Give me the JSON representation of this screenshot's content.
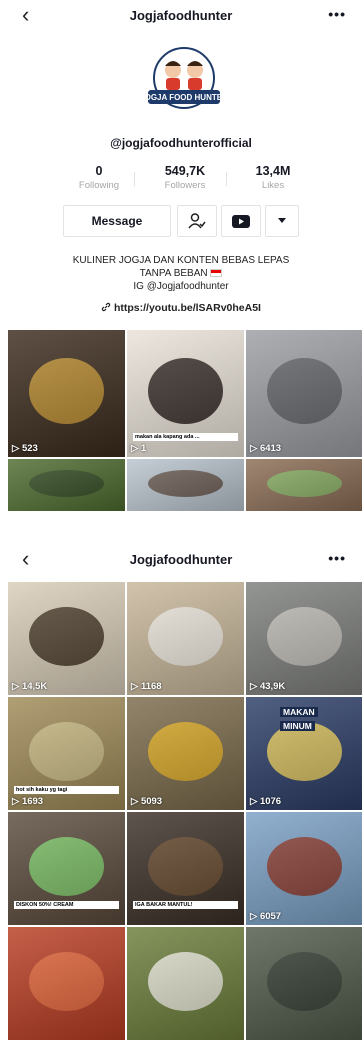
{
  "header": {
    "title": "Jogjafoodhunter",
    "back_icon": "chevron-left-icon",
    "more_icon": "more-dots-icon"
  },
  "profile": {
    "logo_text": "JOGJA FOOD HUNTER",
    "handle": "@jogjafoodhunterofficial",
    "stats": [
      {
        "value": "0",
        "label": "Following"
      },
      {
        "value": "549,7K",
        "label": "Followers"
      },
      {
        "value": "13,4M",
        "label": "Likes"
      }
    ],
    "message_label": "Message",
    "bio_line1": "KULINER JOGJA DAN KONTEN BEBAS LEPAS",
    "bio_line2": "TANPA BEBAN",
    "bio_line3": "IG @Jogjafoodhunter",
    "link": "https://youtu.be/lSARv0heA5I"
  },
  "grid1": [
    {
      "views": "523",
      "bg": "#3b2a1c",
      "accent": "#c9962f"
    },
    {
      "views": "1",
      "bg": "#e9e2d8",
      "accent": "#1e1410",
      "caption": "makan ala kapang ada ..."
    },
    {
      "views": "6413",
      "bg": "#9c9ea3",
      "accent": "#5a5c61"
    },
    {
      "views": "",
      "bg": "#4d6b2e",
      "accent": "#2f4520"
    },
    {
      "views": "",
      "bg": "#b9c3cd",
      "accent": "#5d4c3f"
    },
    {
      "views": "",
      "bg": "#8a6c54",
      "accent": "#86b965"
    }
  ],
  "grid2": [
    {
      "views": "14,5K",
      "bg": "#d8cdb8",
      "accent": "#3a2a18"
    },
    {
      "views": "1168",
      "bg": "#c8b79a",
      "accent": "#f2efe8"
    },
    {
      "views": "43,9K",
      "bg": "#7d7f7c",
      "accent": "#c9c6bf"
    },
    {
      "views": "1693",
      "bg": "#9f8a57",
      "accent": "#cfc08a",
      "caption": "hot sih kaku yg tagi"
    },
    {
      "views": "5093",
      "bg": "#7a6a4a",
      "accent": "#e6b01f"
    },
    {
      "views": "1076",
      "bg": "#2b3c66",
      "accent": "#f0d15a",
      "sign1": "MAKAN",
      "sign2": "MINUM"
    },
    {
      "views": "",
      "bg": "#5a4a3c",
      "accent": "#7fd06a",
      "caption": "DISKON 50%! CREAM"
    },
    {
      "views": "",
      "bg": "#3a2f26",
      "accent": "#6b4b2e",
      "caption": "IGA BAKAR MANTUL!"
    },
    {
      "views": "6057",
      "bg": "#7aa0c4",
      "accent": "#8b2f1e"
    },
    {
      "views": "",
      "bg": "#b83c22",
      "accent": "#e86a3c"
    },
    {
      "views": "",
      "bg": "#6b7d3a",
      "accent": "#f1efe4"
    },
    {
      "views": "",
      "bg": "#4f5a4a",
      "accent": "#2f382e"
    }
  ]
}
